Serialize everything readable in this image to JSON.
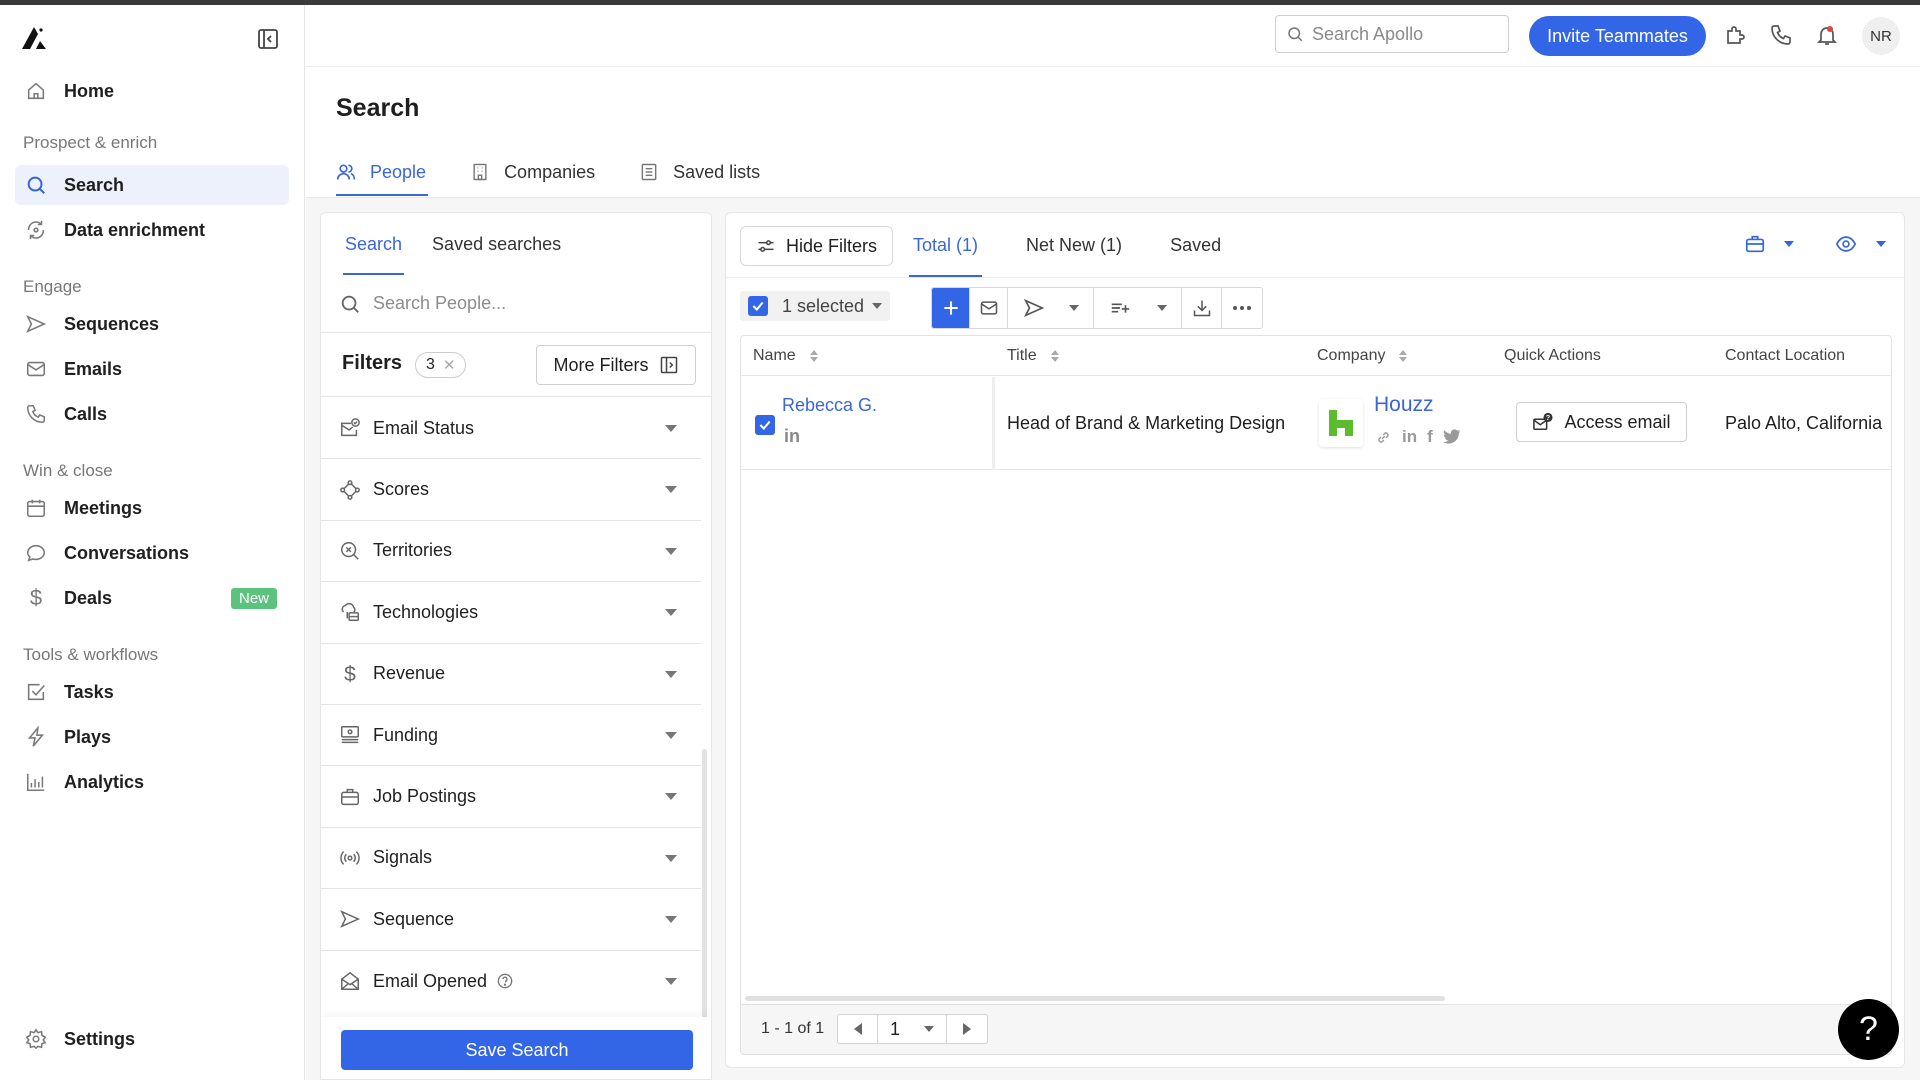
{
  "sidebar": {
    "home": "Home",
    "sections": {
      "prospect": "Prospect & enrich",
      "engage": "Engage",
      "win": "Win & close",
      "tools": "Tools & workflows"
    },
    "items": {
      "search": "Search",
      "enrichment": "Data enrichment",
      "sequences": "Sequences",
      "emails": "Emails",
      "calls": "Calls",
      "meetings": "Meetings",
      "conversations": "Conversations",
      "deals": "Deals",
      "deals_badge": "New",
      "tasks": "Tasks",
      "plays": "Plays",
      "analytics": "Analytics",
      "settings": "Settings"
    }
  },
  "topbar": {
    "search_placeholder": "Search Apollo",
    "invite_label": "Invite Teammates",
    "avatar_initials": "NR"
  },
  "page": {
    "title": "Search",
    "tabs": [
      "People",
      "Companies",
      "Saved lists"
    ]
  },
  "filters": {
    "tabs": [
      "Search",
      "Saved searches"
    ],
    "search_placeholder": "Search People...",
    "title": "Filters",
    "count": "3",
    "more_filters": "More Filters",
    "items": [
      "Email Status",
      "Scores",
      "Territories",
      "Technologies",
      "Revenue",
      "Funding",
      "Job Postings",
      "Signals",
      "Sequence",
      "Email Opened"
    ],
    "save_label": "Save Search"
  },
  "results": {
    "hide_filters": "Hide Filters",
    "tabs": [
      "Total (1)",
      "Net New (1)",
      "Saved"
    ],
    "selected_label": "1 selected",
    "columns": [
      "Name",
      "Title",
      "Company",
      "Quick Actions",
      "Contact Location"
    ],
    "rows": [
      {
        "name": "Rebecca G.",
        "linkedin": "in",
        "title": "Head of Brand & Marketing Design",
        "company": "Houzz",
        "quick_action": "Access email",
        "location": "Palo Alto, California"
      }
    ],
    "pager": {
      "range": "1 - 1 of 1",
      "page": "1"
    }
  },
  "help_label": "?",
  "colors": {
    "accent": "#3366e6",
    "link": "#3a66d8",
    "badge_new": "#5cc37e",
    "houzz_green": "#5dbb2e"
  }
}
